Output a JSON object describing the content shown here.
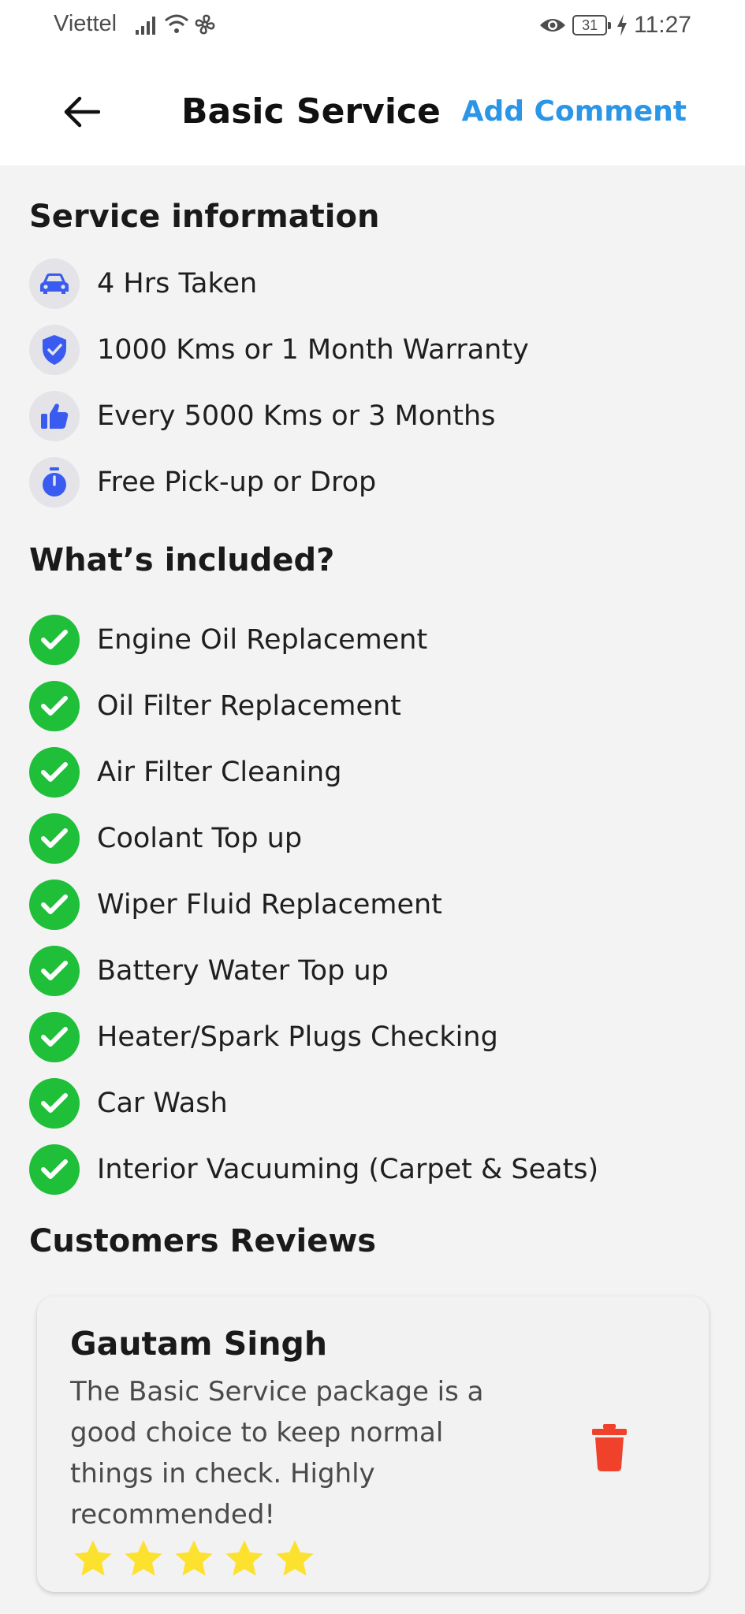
{
  "status_bar": {
    "carrier": "Viettel",
    "battery": "31",
    "time": "11:27"
  },
  "app_bar": {
    "title": "Basic Service",
    "action": "Add Comment"
  },
  "service_info": {
    "heading": "Service information",
    "items": [
      {
        "icon": "car-icon",
        "text": "4 Hrs Taken"
      },
      {
        "icon": "shield-check-icon",
        "text": "1000 Kms or 1 Month Warranty"
      },
      {
        "icon": "thumbs-up-icon",
        "text": "Every 5000 Kms or 3 Months"
      },
      {
        "icon": "stopwatch-icon",
        "text": "Free Pick-up or Drop"
      }
    ]
  },
  "included": {
    "heading": "What’s included?",
    "items": [
      "Engine Oil Replacement",
      "Oil Filter Replacement",
      "Air Filter Cleaning",
      "Coolant Top up",
      "Wiper Fluid Replacement",
      "Battery Water Top up",
      "Heater/Spark Plugs Checking",
      "Car Wash",
      "Interior Vacuuming (Carpet & Seats)"
    ]
  },
  "reviews": {
    "heading": "Customers Reviews",
    "items": [
      {
        "name": "Gautam Singh",
        "text": "The Basic Service package is a good choice to keep normal things in check. Highly recommended!",
        "rating": 5,
        "max_rating": 5
      }
    ]
  },
  "colors": {
    "accent": "#2b95e6",
    "icon_blue": "#3a5bef",
    "check_green": "#1fbf3a",
    "delete_red": "#f0412b",
    "star_yellow": "#fde12f"
  }
}
